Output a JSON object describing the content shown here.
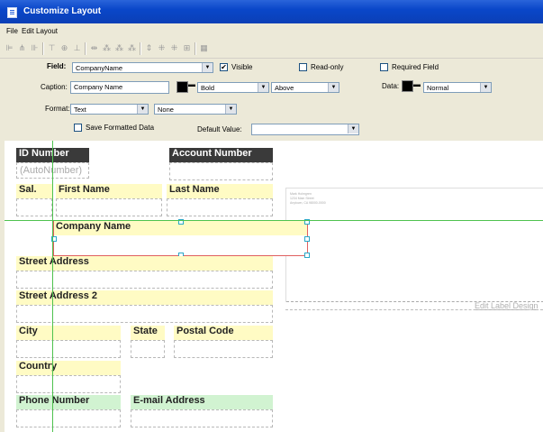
{
  "window": {
    "title": "Customize Layout"
  },
  "menu": [
    "File",
    "Edit",
    "Layout"
  ],
  "toolbar_icons": [
    "align-left-icon",
    "align-center-icon",
    "align-right-icon",
    "align-top-icon",
    "align-middle-icon",
    "align-bottom-icon",
    "space-horizontal-icon",
    "space-across-icon",
    "space-down-icon",
    "space-even-icon",
    "same-width-icon",
    "same-height-icon",
    "same-size-icon",
    "size-fit-icon",
    "grid-icon"
  ],
  "properties": {
    "field_label": "Field:",
    "field_value": "CompanyName",
    "visible_label": "Visible",
    "visible_checked": true,
    "readonly_label": "Read-only",
    "readonly_checked": false,
    "required_label": "Required Field",
    "required_checked": false,
    "caption_label": "Caption:",
    "caption_value": "Company Name",
    "caption_style": "Bold",
    "caption_position": "Above",
    "data_label": "Data:",
    "data_style": "Normal",
    "format_label": "Format:",
    "format_value": "Text",
    "format_option": "None",
    "save_formatted_label": "Save Formatted Data",
    "save_formatted_checked": false,
    "default_value_label": "Default Value:",
    "default_value": ""
  },
  "layout_fields": {
    "id_number": {
      "label": "ID Number",
      "placeholder": "(AutoNumber)"
    },
    "account_number": {
      "label": "Account Number"
    },
    "sal": {
      "label": "Sal."
    },
    "first_name": {
      "label": "First Name"
    },
    "last_name": {
      "label": "Last Name"
    },
    "company_name": {
      "label": "Company Name"
    },
    "street_address": {
      "label": "Street Address"
    },
    "street_address_2": {
      "label": "Street Address 2"
    },
    "city": {
      "label": "City"
    },
    "state": {
      "label": "State"
    },
    "postal_code": {
      "label": "Postal Code"
    },
    "country": {
      "label": "Country"
    },
    "phone_number": {
      "label": "Phone Number"
    },
    "email_address": {
      "label": "E-mail Address"
    }
  },
  "label_preview": {
    "line1": "Mark Holmgren",
    "line2": "1234 Main Street",
    "line3": "Anytown, CA 98000-0000",
    "edit_link": "Edit Label Design"
  },
  "colors": {
    "caption_fill": "#fffbc4",
    "caption_dark": "#3a3a3a",
    "phone_fill": "#d1f3d1",
    "guide_line": "#4ec24e",
    "titlebar": "#0a47c9"
  }
}
